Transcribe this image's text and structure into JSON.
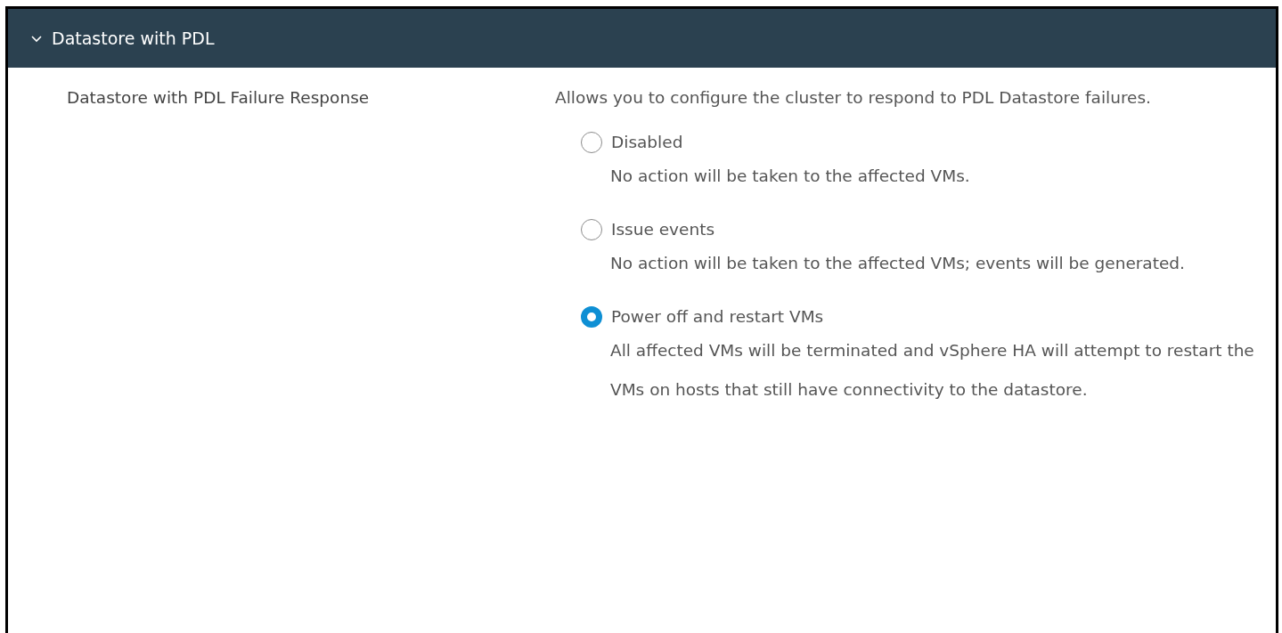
{
  "section": {
    "title": "Datastore with PDL",
    "expanded": true
  },
  "setting": {
    "label": "Datastore with PDL Failure Response",
    "description": "Allows you to configure the cluster to respond to PDL Datastore failures."
  },
  "options": [
    {
      "label": "Disabled",
      "description": "No action will be taken to the affected VMs.",
      "selected": false
    },
    {
      "label": "Issue events",
      "description": "No action will be taken to the affected VMs; events will be generated.",
      "selected": false
    },
    {
      "label": "Power off and restart VMs",
      "description": "All affected VMs will be terminated and vSphere HA will attempt to restart the VMs on hosts that still have connectivity to the datastore.",
      "selected": true
    }
  ]
}
